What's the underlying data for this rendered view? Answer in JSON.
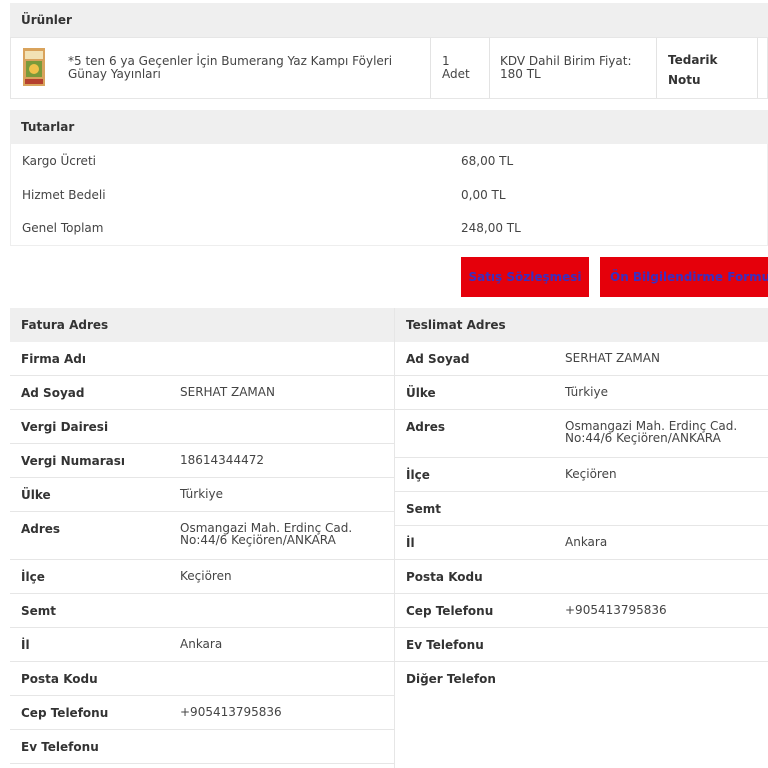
{
  "products": {
    "section_title": "Ürünler",
    "items": [
      {
        "name": "*5 ten 6 ya Geçenler İçin Bumerang Yaz Kampı Föyleri Günay Yayınları",
        "quantity_line1": "1",
        "quantity_line2": "Adet",
        "price_line1": "KDV Dahil Birim Fiyat:",
        "price_line2": "180 TL",
        "note_line1": "Tedarik",
        "note_line2": "Notu",
        "thumbnail_icon": "book-cover-icon"
      }
    ]
  },
  "totals": {
    "section_title": "Tutarlar",
    "rows": [
      {
        "label": "Kargo Ücreti",
        "value": "68,00 TL"
      },
      {
        "label": "Hizmet Bedeli",
        "value": "0,00 TL"
      },
      {
        "label": "Genel Toplam",
        "value": "248,00 TL"
      }
    ]
  },
  "actions": {
    "sales_contract": "Satış Sözleşmesi",
    "preliminary_info_form": "Ön Bilgilendirme Formu"
  },
  "billing": {
    "section_title": "Fatura Adres",
    "rows": [
      {
        "label": "Firma Adı",
        "value": ""
      },
      {
        "label": "Ad Soyad",
        "value": "SERHAT ZAMAN"
      },
      {
        "label": "Vergi Dairesi",
        "value": ""
      },
      {
        "label": "Vergi Numarası",
        "value": "18614344472"
      },
      {
        "label": "Ülke",
        "value": "Türkiye"
      },
      {
        "label": "Adres",
        "value": "Osmangazi Mah. Erdinç Cad. No:44/6 Keçiören/ANKARA"
      },
      {
        "label": "İlçe",
        "value": "Keçiören"
      },
      {
        "label": "Semt",
        "value": ""
      },
      {
        "label": "İl",
        "value": "Ankara"
      },
      {
        "label": "Posta Kodu",
        "value": ""
      },
      {
        "label": "Cep Telefonu",
        "value": "+905413795836"
      },
      {
        "label": "Ev Telefonu",
        "value": ""
      }
    ]
  },
  "shipping": {
    "section_title": "Teslimat Adres",
    "rows": [
      {
        "label": "Ad Soyad",
        "value": "SERHAT ZAMAN"
      },
      {
        "label": "Ülke",
        "value": "Türkiye"
      },
      {
        "label": "Adres",
        "value": "Osmangazi Mah. Erdinç Cad. No:44/6 Keçiören/ANKARA"
      },
      {
        "label": "İlçe",
        "value": "Keçiören"
      },
      {
        "label": "Semt",
        "value": ""
      },
      {
        "label": "İl",
        "value": "Ankara"
      },
      {
        "label": "Posta Kodu",
        "value": ""
      },
      {
        "label": "Cep Telefonu",
        "value": "+905413795836"
      },
      {
        "label": "Ev Telefonu",
        "value": ""
      },
      {
        "label": "Diğer Telefon",
        "value": ""
      }
    ]
  },
  "colors": {
    "button_bg": "#e5000b",
    "button_text": "#3a2ec0",
    "header_bg": "#efefef"
  }
}
